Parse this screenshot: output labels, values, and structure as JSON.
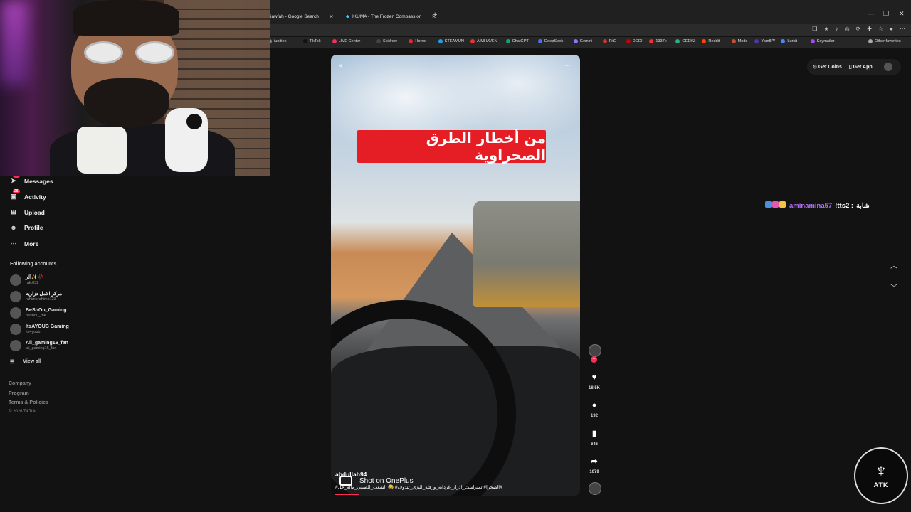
{
  "browser": {
    "tabs": [
      {
        "title": "iawfah - Google Search"
      },
      {
        "title": "IKUMA - The Frozen Compass on"
      }
    ],
    "bookmarks": [
      "iunities",
      "TikTok",
      "LIVE Center",
      "Skidrow",
      "Horror",
      "STEAMUN",
      "AIMHAVEN",
      "ChatGPT",
      "DeepSeek",
      "Gemini",
      "FitG",
      "DODI",
      "1337x",
      "GEEKZ",
      "Reddit",
      "Mods",
      "Yam8™",
      "Lurkit",
      "Keymailer",
      "Other favorites"
    ]
  },
  "sidebar": {
    "items": [
      {
        "label": "Messages",
        "icon": "send-icon",
        "badge": "54"
      },
      {
        "label": "Activity",
        "icon": "inbox-icon",
        "badge": "26"
      },
      {
        "label": "Upload",
        "icon": "plus-square-icon",
        "badge": ""
      },
      {
        "label": "Profile",
        "icon": "avatar-icon",
        "badge": ""
      },
      {
        "label": "More",
        "icon": "ellipsis-icon",
        "badge": ""
      }
    ],
    "following_title": "Following accounts",
    "accounts": [
      {
        "name": "آلر✨🥀",
        "username": "rak.032"
      },
      {
        "name": "مركز الامل دزاريه",
        "username": "rahimorahimo123"
      },
      {
        "name": "BeShOu_Gaming",
        "username": "beshou_mk"
      },
      {
        "name": "ItsAYOUB Gaming",
        "username": "its4youb"
      },
      {
        "name": "Ali_gaming16_fan",
        "username": "ali_gaming16_fan"
      }
    ],
    "view_all": "View all",
    "footer": [
      "Company",
      "Program",
      "Terms & Policies"
    ],
    "copyright": "© 2026 TikTok"
  },
  "video": {
    "banner_text": "من أخطار الطرق الصحراوية",
    "username": "abdullah94",
    "watermark": "Shot on OnePlus",
    "description": "#الصحرا# تمنراست_ادرار_غرداية_ورقلة_اليزي_تندوف# 😂 الشعب_الصيني_ماله_حل#",
    "progress": 0.1
  },
  "actions": {
    "likes": "18.5K",
    "comments": "192",
    "saves": "646",
    "shares": "1079"
  },
  "topbar": {
    "get_coins": "Get Coins",
    "get_app": "Get App"
  },
  "chat": {
    "prefix": "شابة",
    "message": "!tts2 :",
    "user": "aminamina57"
  },
  "logo_text": "ATK"
}
